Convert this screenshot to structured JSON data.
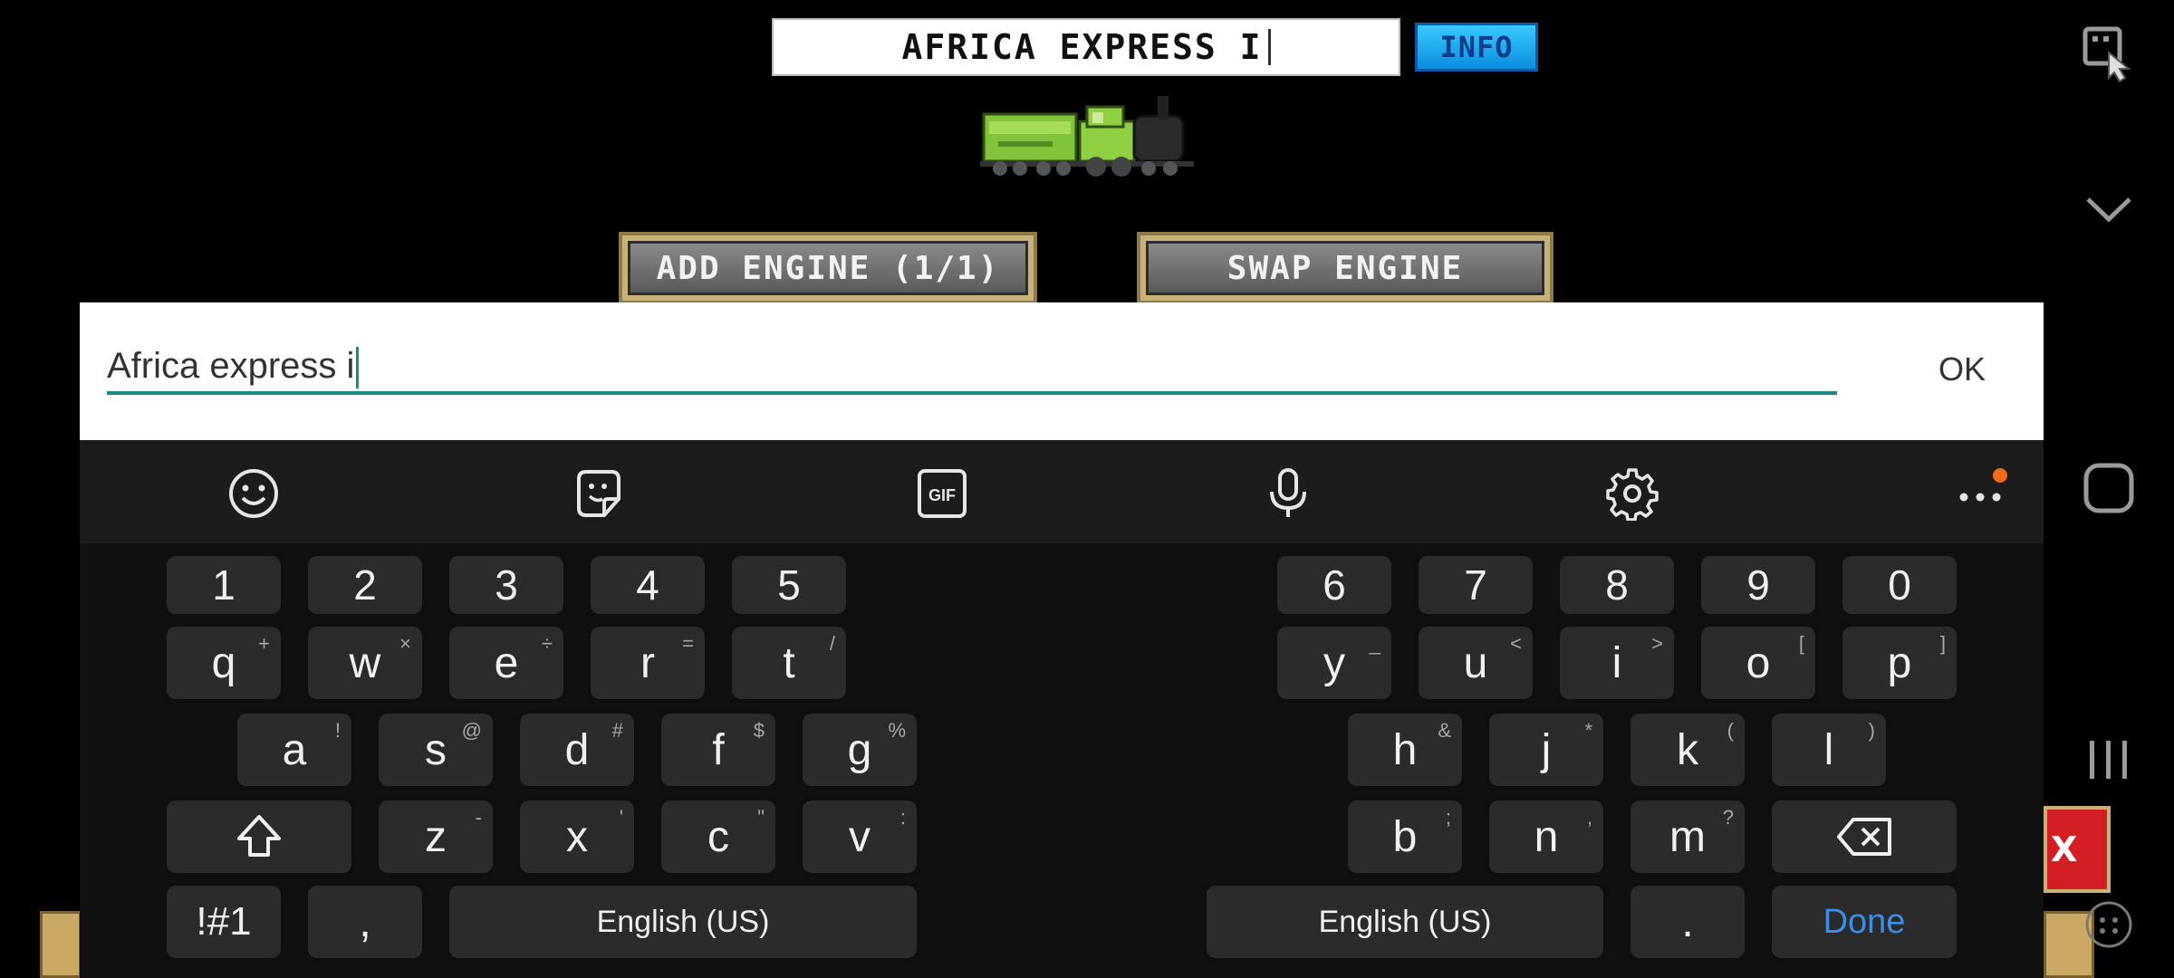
{
  "game": {
    "train_name": "AFRICA EXPRESS I",
    "info_label": "INFO",
    "add_engine_label": "ADD ENGINE (1/1)",
    "swap_engine_label": "SWAP ENGINE",
    "red_button_label": "X"
  },
  "dialog": {
    "input_value": "Africa express i",
    "ok_label": "OK"
  },
  "keyboard": {
    "toolbar": [
      "emoji-icon",
      "sticker-icon",
      "gif-icon",
      "microphone-icon",
      "settings-icon",
      "more-icon"
    ],
    "gif_label": "GIF",
    "number_row_left": [
      "1",
      "2",
      "3",
      "4",
      "5"
    ],
    "number_row_right": [
      "6",
      "7",
      "8",
      "9",
      "0"
    ],
    "row1_left": [
      {
        "k": "q",
        "s": "+"
      },
      {
        "k": "w",
        "s": "×"
      },
      {
        "k": "e",
        "s": "÷"
      },
      {
        "k": "r",
        "s": "="
      },
      {
        "k": "t",
        "s": "/"
      }
    ],
    "row1_right": [
      {
        "k": "y",
        "s": "_"
      },
      {
        "k": "u",
        "s": "<"
      },
      {
        "k": "i",
        "s": ">"
      },
      {
        "k": "o",
        "s": "["
      },
      {
        "k": "p",
        "s": "]"
      }
    ],
    "row2_left": [
      {
        "k": "a",
        "s": "!"
      },
      {
        "k": "s",
        "s": "@"
      },
      {
        "k": "d",
        "s": "#"
      },
      {
        "k": "f",
        "s": "$"
      },
      {
        "k": "g",
        "s": "%"
      }
    ],
    "row2_right": [
      {
        "k": "h",
        "s": "&"
      },
      {
        "k": "j",
        "s": "*"
      },
      {
        "k": "k",
        "s": "("
      },
      {
        "k": "l",
        "s": ")"
      }
    ],
    "row3_left": [
      {
        "k": "z",
        "s": "-"
      },
      {
        "k": "x",
        "s": "'"
      },
      {
        "k": "c",
        "s": "\""
      },
      {
        "k": "v",
        "s": ":"
      }
    ],
    "row3_right": [
      {
        "k": "b",
        "s": ";"
      },
      {
        "k": "n",
        "s": ","
      },
      {
        "k": "m",
        "s": "?"
      }
    ],
    "symbols_label": "!#1",
    "comma_label": ",",
    "space_left_label": "English (US)",
    "space_right_label": "English (US)",
    "period_label": ".",
    "done_label": "Done",
    "accent_color": "#3a8ee6",
    "notification_dot_color": "#f26b1d"
  },
  "system_bar": {
    "icons": [
      "keyboard-switch-icon",
      "chevron-down-icon",
      "home-icon",
      "recents-icon",
      "game-tools-icon"
    ]
  }
}
